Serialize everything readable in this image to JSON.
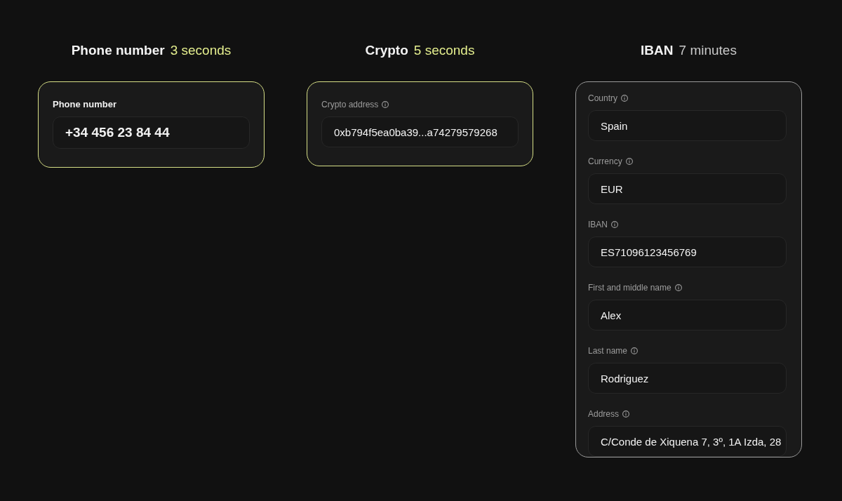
{
  "columns": [
    {
      "title": "Phone number",
      "time": "3 seconds",
      "highlighted": true,
      "fields": [
        {
          "kind": "prominent",
          "label": "Phone number",
          "info": false,
          "value": "+34 456 23 84 44"
        }
      ]
    },
    {
      "title": "Crypto",
      "time": "5 seconds",
      "highlighted": true,
      "fields": [
        {
          "kind": "standard",
          "label": "Crypto address",
          "info": true,
          "value": "0xb794f5ea0ba39...a74279579268"
        }
      ]
    },
    {
      "title": "IBAN",
      "time": "7 minutes",
      "highlighted": false,
      "fields": [
        {
          "kind": "standard",
          "label": "Country",
          "info": true,
          "value": "Spain"
        },
        {
          "kind": "standard",
          "label": "Currency",
          "info": true,
          "value": "EUR"
        },
        {
          "kind": "standard",
          "label": "IBAN",
          "info": true,
          "value": "ES71096123456769"
        },
        {
          "kind": "standard",
          "label": "First and middle name",
          "info": true,
          "value": "Alex"
        },
        {
          "kind": "standard",
          "label": "Last name",
          "info": true,
          "value": "Rodriguez"
        },
        {
          "kind": "standard",
          "label": "Address",
          "info": true,
          "value": "C/Conde de Xiquena 7, 3º, 1A Izda, 28"
        }
      ]
    }
  ]
}
